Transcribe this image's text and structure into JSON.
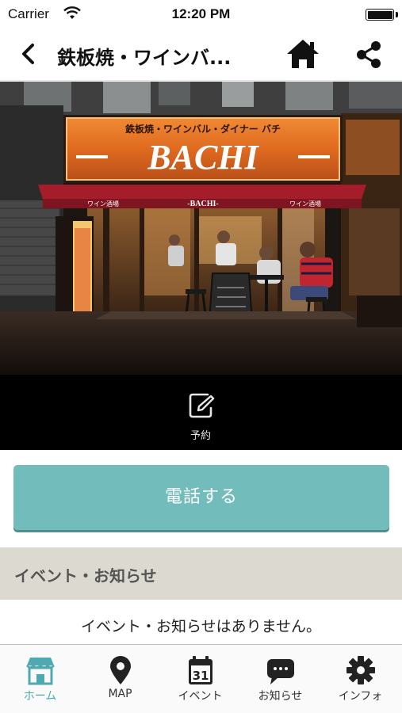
{
  "status": {
    "carrier": "Carrier",
    "time": "12:20 PM"
  },
  "nav": {
    "title": "鉄板焼・ワインバ..."
  },
  "hero": {
    "sign_sub": "鉄板焼・ワインバル・ダイナー バチ",
    "sign_main": "BACHI",
    "awning_left": "ワイン酒場",
    "awning_center": "-BACHI-",
    "awning_right": "ワイン酒場"
  },
  "reserve": {
    "label": "予約"
  },
  "call": {
    "label": "電話する"
  },
  "events": {
    "title": "イベント・お知らせ",
    "empty": "イベント・お知らせはありません。"
  },
  "tabs": [
    {
      "label": "ホーム",
      "icon": "shop-icon",
      "active": true
    },
    {
      "label": "MAP",
      "icon": "map-pin-icon",
      "active": false
    },
    {
      "label": "イベント",
      "icon": "calendar-icon",
      "active": false,
      "calendar_day": "31"
    },
    {
      "label": "お知らせ",
      "icon": "chat-bubble-icon",
      "active": false
    },
    {
      "label": "インフォ",
      "icon": "gear-icon",
      "active": false
    }
  ],
  "colors": {
    "accent": "#72bcbb",
    "tab_active": "#4ea9b2",
    "section_bg": "#dcdad0",
    "sign_orange": "#e0762a"
  }
}
